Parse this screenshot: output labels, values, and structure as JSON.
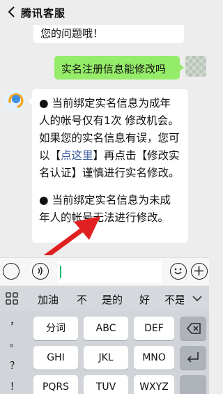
{
  "header": {
    "title": "腾讯客服"
  },
  "messages": {
    "prev_bot": "您的问题哦！",
    "user": "实名注册信息能修改吗",
    "bot": {
      "p1_a": "● 当前绑定实名信息为成年人的帐号仅有1次 修改机会。如果您的实名信息有误，您可以【",
      "p1_link": "点这里",
      "p1_b": "】再点击【修改实名认证】谨慎进行实名修改。",
      "p2": "● 当前绑定实名信息为未成年人的帐号无法进行修改。"
    }
  },
  "suggestions": [
    "加油",
    "不",
    "是的",
    "好",
    "不是"
  ],
  "keyboard": {
    "punct": [
      "，",
      "。",
      "？",
      "！"
    ],
    "row1": [
      "分词",
      "ABC",
      "DEF"
    ],
    "row2": [
      "GHI",
      "JKL",
      "MNO"
    ],
    "row3": [
      "PQRS",
      "TUV",
      "WXYZ"
    ]
  },
  "colors": {
    "user_bubble": "#95ec69",
    "link": "#3a5a9c",
    "arrow": "#e02020"
  }
}
